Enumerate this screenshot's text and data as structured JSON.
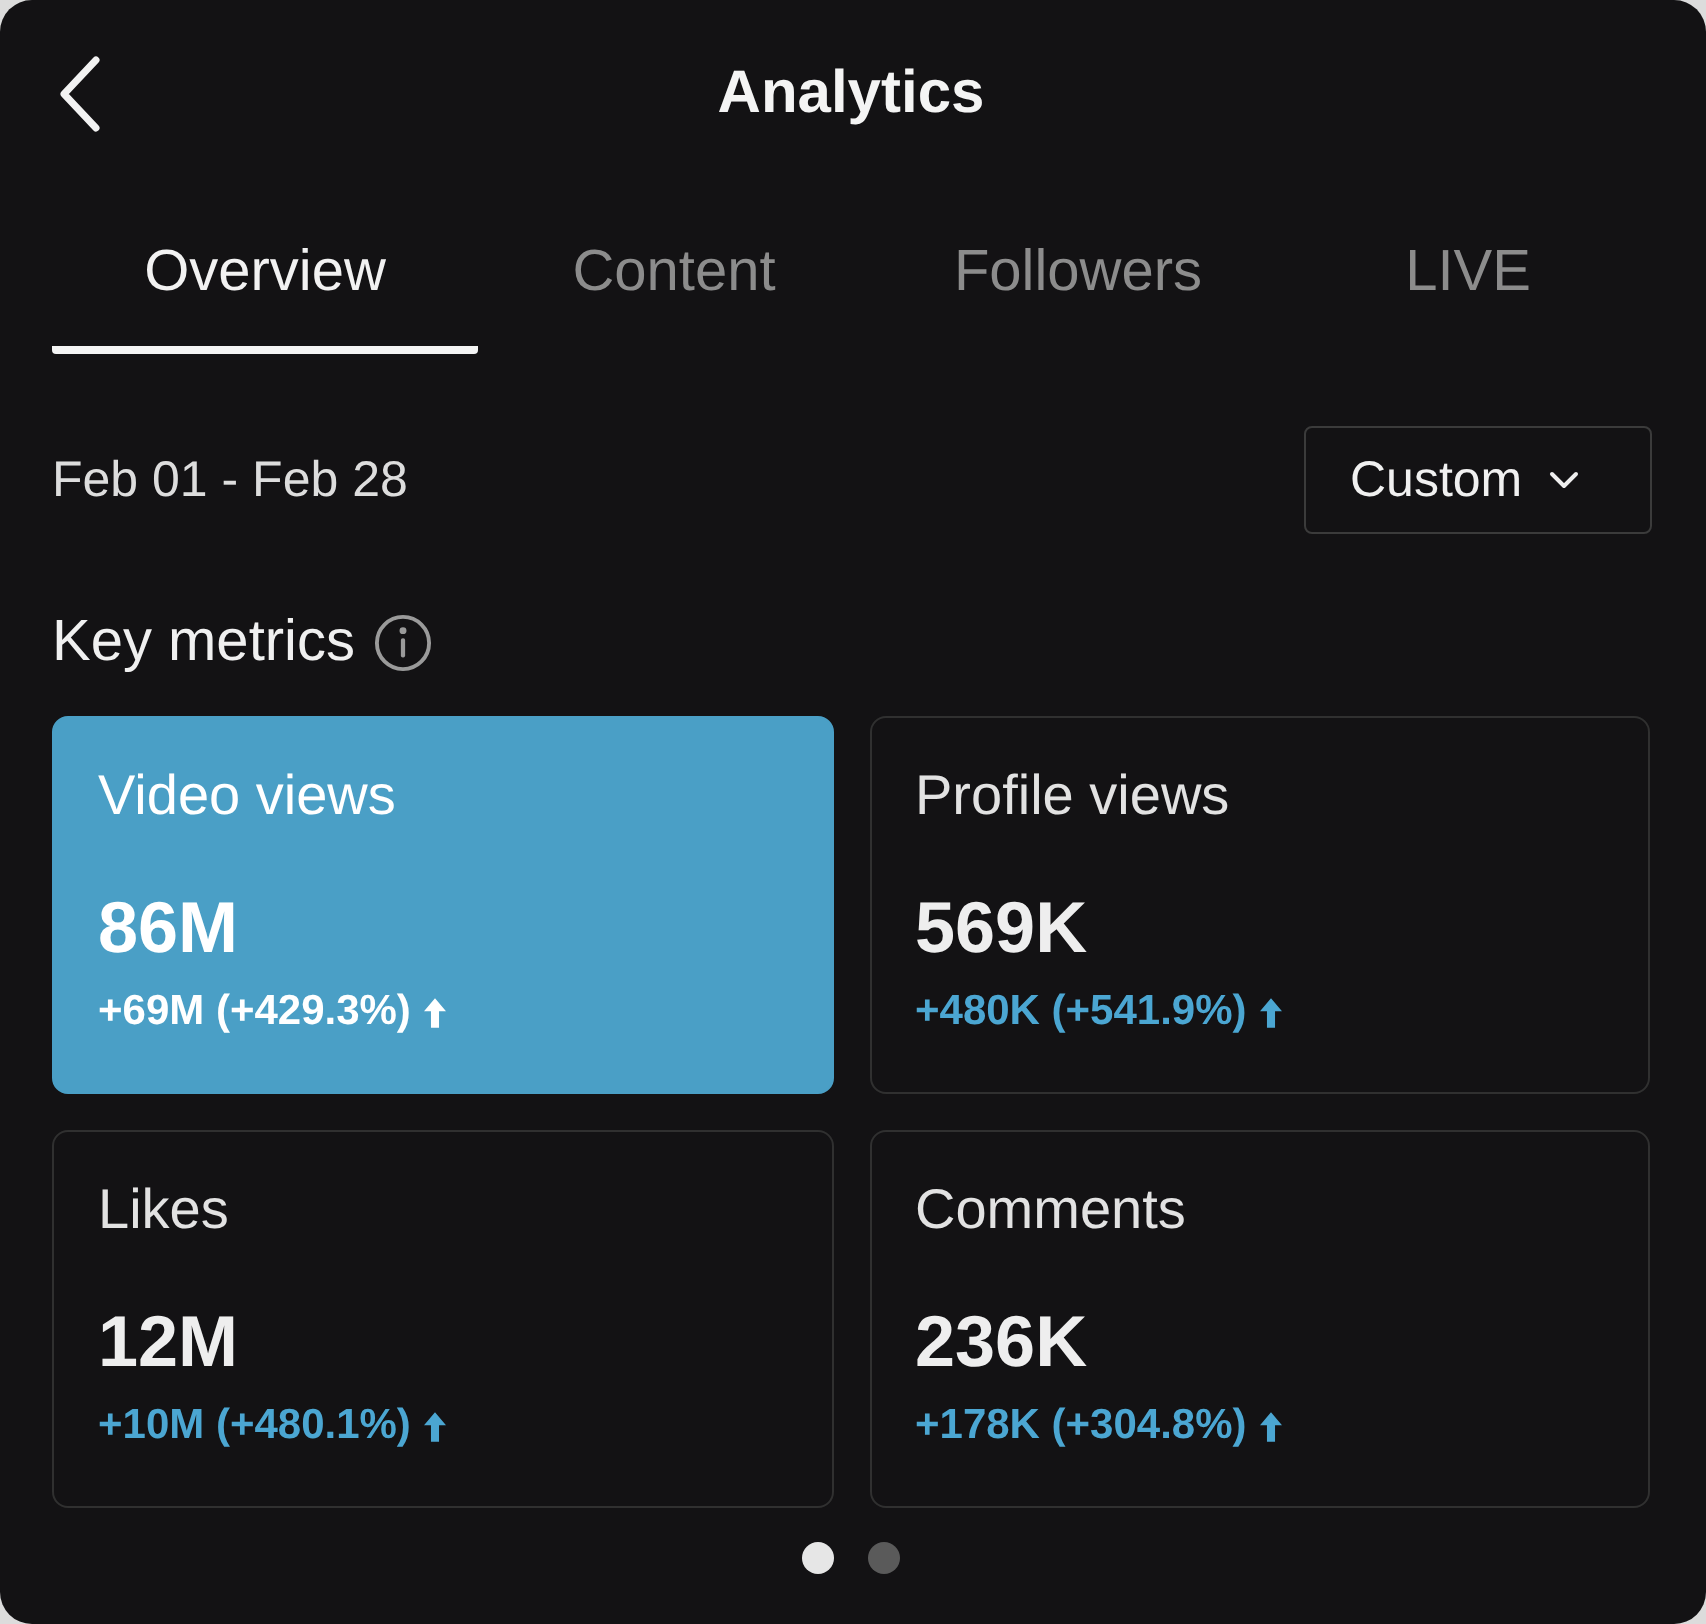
{
  "header": {
    "title": "Analytics"
  },
  "tabs": [
    {
      "label": "Overview",
      "selected": true
    },
    {
      "label": "Content",
      "selected": false
    },
    {
      "label": "Followers",
      "selected": false
    },
    {
      "label": "LIVE",
      "selected": false
    }
  ],
  "date_range": {
    "label": "Feb 01 - Feb 28",
    "dropdown": "Custom"
  },
  "key_metrics": {
    "title": "Key metrics",
    "metrics": [
      {
        "label": "Video views",
        "value": "86M",
        "change": "+69M (+429.3%)",
        "kind": "increase",
        "selected": true
      },
      {
        "label": "Profile views",
        "value": "569K",
        "change": "+480K (+541.9%)",
        "kind": "increase",
        "selected": false
      },
      {
        "label": "Likes",
        "value": "12M",
        "change": "+10M (+480.1%)",
        "kind": "increase",
        "selected": false
      },
      {
        "label": "Comments",
        "value": "236K",
        "change": "+178K (+304.8%)",
        "kind": "increase",
        "selected": false
      }
    ]
  },
  "pager": [
    {
      "selected": true
    },
    {
      "selected": false
    }
  ]
}
